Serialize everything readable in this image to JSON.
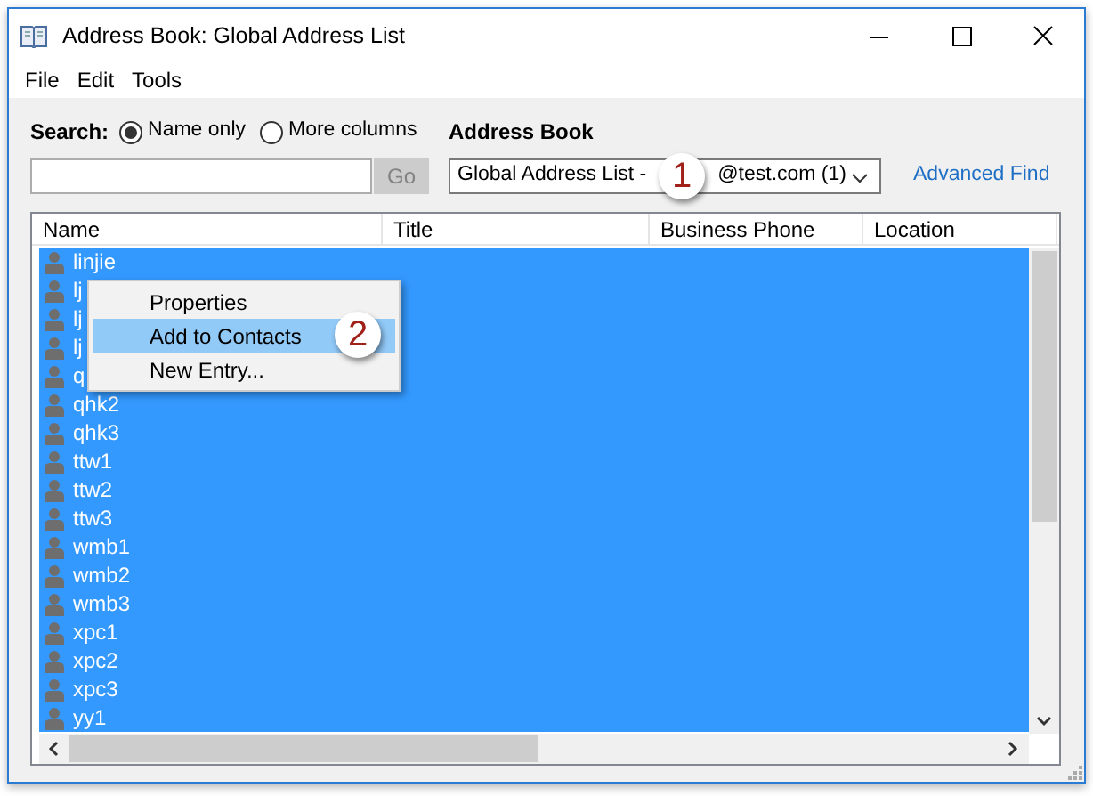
{
  "window": {
    "title": "Address Book: Global Address List"
  },
  "menu": [
    "File",
    "Edit",
    "Tools"
  ],
  "search": {
    "label": "Search:",
    "options": [
      {
        "label": "Name only",
        "selected": true
      },
      {
        "label": "More columns",
        "selected": false
      }
    ],
    "go_button": {
      "label": "Go",
      "disabled": true
    }
  },
  "address_book": {
    "label": "Address Book",
    "value_start": "Global Address List -",
    "value_end": "@test.com (1)",
    "callout": "1"
  },
  "advanced_find": "Advanced Find",
  "table": {
    "columns": [
      "Name",
      "Title",
      "Business Phone",
      "Location"
    ],
    "rows": [
      {
        "name": "linjie",
        "selected": true
      },
      {
        "name": "lj",
        "selected": true
      },
      {
        "name": "lj",
        "selected": true
      },
      {
        "name": "lj",
        "selected": true
      },
      {
        "name": "q",
        "selected": true
      },
      {
        "name": "qhk2",
        "selected": true
      },
      {
        "name": "qhk3",
        "selected": true
      },
      {
        "name": "ttw1",
        "selected": true
      },
      {
        "name": "ttw2",
        "selected": true
      },
      {
        "name": "ttw3",
        "selected": true
      },
      {
        "name": "wmb1",
        "selected": true
      },
      {
        "name": "wmb2",
        "selected": true
      },
      {
        "name": "wmb3",
        "selected": true
      },
      {
        "name": "xpc1",
        "selected": true
      },
      {
        "name": "xpc2",
        "selected": true
      },
      {
        "name": "xpc3",
        "selected": true
      },
      {
        "name": "yy1",
        "selected": true
      }
    ]
  },
  "context_menu": {
    "items": [
      {
        "label": "Properties",
        "selected": false
      },
      {
        "label": "Add to Contacts",
        "selected": true,
        "callout": "2"
      },
      {
        "label": "New Entry...",
        "selected": false
      }
    ]
  }
}
